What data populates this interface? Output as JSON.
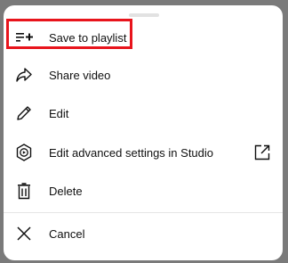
{
  "menu": {
    "items": [
      {
        "label": "Save to playlist",
        "icon": "playlist-add-icon"
      },
      {
        "label": "Share video",
        "icon": "share-icon"
      },
      {
        "label": "Edit",
        "icon": "pencil-icon"
      },
      {
        "label": "Edit advanced settings in Studio",
        "icon": "studio-icon",
        "trailing_icon": "external-link-icon"
      },
      {
        "label": "Delete",
        "icon": "trash-icon"
      }
    ],
    "cancel_label": "Cancel",
    "cancel_icon": "close-icon"
  },
  "colors": {
    "highlight": "#e8141c",
    "text": "#0f0f0f",
    "icon": "#0f0f0f"
  }
}
